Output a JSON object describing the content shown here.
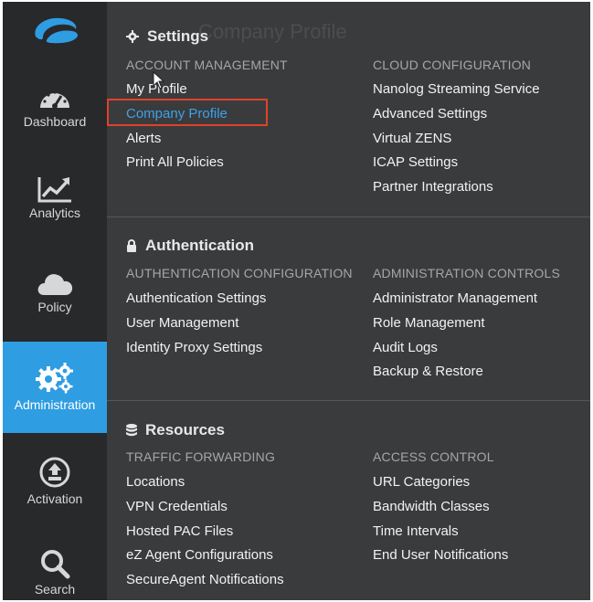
{
  "sidebar": {
    "items": [
      {
        "label": "Dashboard",
        "icon": "dashboard-gauge-icon"
      },
      {
        "label": "Analytics",
        "icon": "analytics-chart-icon"
      },
      {
        "label": "Policy",
        "icon": "cloud-icon"
      },
      {
        "label": "Administration",
        "icon": "gears-icon"
      },
      {
        "label": "Activation",
        "icon": "upload-circle-icon"
      },
      {
        "label": "Search",
        "icon": "search-icon"
      }
    ],
    "active_color": "#2f9de2"
  },
  "background": {
    "title": "Company Profile"
  },
  "settings": {
    "title": "Settings",
    "account_management": {
      "heading": "ACCOUNT MANAGEMENT",
      "links": [
        "My Profile",
        "Company Profile",
        "Alerts",
        "Print All Policies"
      ]
    },
    "cloud_configuration": {
      "heading": "CLOUD CONFIGURATION",
      "links": [
        "Nanolog Streaming Service",
        "Advanced Settings",
        "Virtual ZENS",
        "ICAP Settings",
        "Partner Integrations"
      ]
    }
  },
  "authentication": {
    "title": "Authentication",
    "auth_configuration": {
      "heading": "AUTHENTICATION CONFIGURATION",
      "links": [
        "Authentication Settings",
        "User Management",
        "Identity Proxy Settings"
      ]
    },
    "admin_controls": {
      "heading": "ADMINISTRATION CONTROLS",
      "links": [
        "Administrator Management",
        "Role Management",
        "Audit Logs",
        "Backup & Restore"
      ]
    }
  },
  "resources": {
    "title": "Resources",
    "traffic_forwarding": {
      "heading": "TRAFFIC FORWARDING",
      "links": [
        "Locations",
        "VPN Credentials",
        "Hosted PAC Files",
        "eZ Agent Configurations",
        "SecureAgent Notifications"
      ]
    },
    "access_control": {
      "heading": "ACCESS CONTROL",
      "links": [
        "URL Categories",
        "Bandwidth Classes",
        "Time Intervals",
        "End User Notifications"
      ]
    }
  },
  "colors": {
    "selected_link": "#3aa3ea",
    "highlight_box": "#e0412a"
  }
}
